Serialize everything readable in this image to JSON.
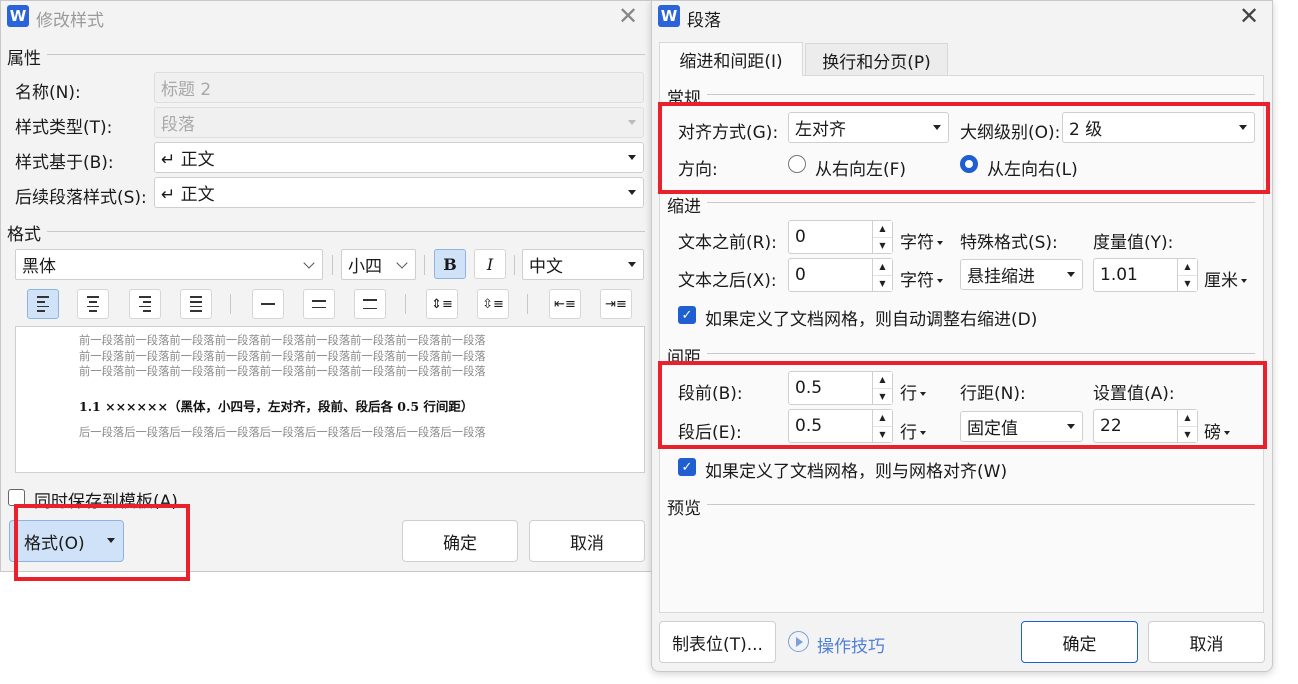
{
  "modify_style": {
    "title": "修改样式",
    "section_properties": "属性",
    "name_label": "名称(N):",
    "name_value": "标题 2",
    "style_type_label": "样式类型(T):",
    "style_type_value": "段落",
    "based_on_label": "样式基于(B):",
    "based_on_value": "↵ 正文",
    "following_label": "后续段落样式(S):",
    "following_value": "↵ 正文",
    "section_format": "格式",
    "font_value": "黑体",
    "size_value": "小四",
    "bold_label": "B",
    "italic_label": "I",
    "script_value": "中文",
    "preview_prev": [
      "前一段落前一段落前一段落前一段落前一段落前一段落前一段落前一段落前一段落",
      "前一段落前一段落前一段落前一段落前一段落前一段落前一段落前一段落前一段落",
      "前一段落前一段落前一段落前一段落前一段落前一段落前一段落前一段落前一段落"
    ],
    "preview_sample": "1.1 ××××××（黑体，小四号，左对齐，段前、段后各 0.5 行间距）",
    "preview_next": "后一段落后一段落后一段落后一段落后一段落后一段落后一段落后一段落后一段落",
    "save_template_label": "同时保存到模板(A)",
    "format_button": "格式(O)",
    "ok_button": "确定",
    "cancel_button": "取消"
  },
  "paragraph": {
    "title": "段落",
    "tabs": [
      {
        "label": "缩进和间距(I)",
        "active": true
      },
      {
        "label": "换行和分页(P)",
        "active": false
      }
    ],
    "general": {
      "heading": "常规",
      "alignment_label": "对齐方式(G):",
      "alignment_value": "左对齐",
      "outline_label": "大纲级别(O):",
      "outline_value": "2 级",
      "direction_label": "方向:",
      "rtl_label": "从右向左(F)",
      "ltr_label": "从左向右(L)",
      "direction_selected": "ltr"
    },
    "indent": {
      "heading": "缩进",
      "before_label": "文本之前(R):",
      "before_value": "0",
      "before_unit": "字符",
      "after_label": "文本之后(X):",
      "after_value": "0",
      "after_unit": "字符",
      "special_label": "特殊格式(S):",
      "special_value": "悬挂缩进",
      "measure_label": "度量值(Y):",
      "measure_value": "1.01",
      "measure_unit": "厘米",
      "auto_adjust_label": "如果定义了文档网格，则自动调整右缩进(D)",
      "auto_adjust_checked": true
    },
    "spacing": {
      "heading": "间距",
      "before_label": "段前(B):",
      "before_value": "0.5",
      "before_unit": "行",
      "after_label": "段后(E):",
      "after_value": "0.5",
      "after_unit": "行",
      "line_label": "行距(N):",
      "line_value": "固定值",
      "setting_label": "设置值(A):",
      "setting_value": "22",
      "setting_unit": "磅",
      "snap_grid_label": "如果定义了文档网格，则与网格对齐(W)",
      "snap_grid_checked": true
    },
    "preview_heading": "预览",
    "tabs_button": "制表位(T)...",
    "tips_label": "操作技巧",
    "ok_button": "确定",
    "cancel_button": "取消"
  },
  "colors": {
    "accent": "#1f5fd1",
    "highlight_box": "#e8212c",
    "dialog_bg": "#f3f3f3"
  }
}
